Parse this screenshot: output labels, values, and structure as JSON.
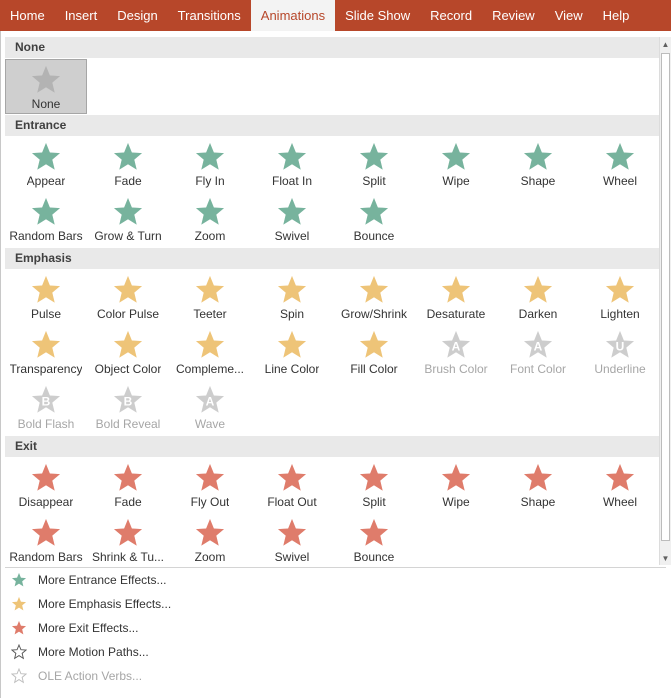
{
  "ribbon": {
    "tabs": [
      {
        "label": "Home",
        "active": false
      },
      {
        "label": "Insert",
        "active": false
      },
      {
        "label": "Design",
        "active": false
      },
      {
        "label": "Transitions",
        "active": false
      },
      {
        "label": "Animations",
        "active": true
      },
      {
        "label": "Slide Show",
        "active": false
      },
      {
        "label": "Record",
        "active": false
      },
      {
        "label": "Review",
        "active": false
      },
      {
        "label": "View",
        "active": false
      },
      {
        "label": "Help",
        "active": false
      }
    ]
  },
  "colors": {
    "ribbon": "#b7472a",
    "entrance": "#4a9a7c",
    "emphasis": "#e8b04b",
    "exit": "#d5503a",
    "disabled": "#bdbdbd",
    "none": "#9a9a9a"
  },
  "gallery": {
    "sections": [
      {
        "title": "None",
        "kind": "none",
        "items": [
          {
            "label": "None",
            "icon": "none-star-icon",
            "selected": true
          }
        ]
      },
      {
        "title": "Entrance",
        "kind": "entrance",
        "items": [
          {
            "label": "Appear",
            "icon": "appear-icon"
          },
          {
            "label": "Fade",
            "icon": "fade-icon"
          },
          {
            "label": "Fly In",
            "icon": "fly-in-icon"
          },
          {
            "label": "Float In",
            "icon": "float-in-icon"
          },
          {
            "label": "Split",
            "icon": "split-icon"
          },
          {
            "label": "Wipe",
            "icon": "wipe-icon"
          },
          {
            "label": "Shape",
            "icon": "shape-icon"
          },
          {
            "label": "Wheel",
            "icon": "wheel-icon"
          },
          {
            "label": "Random Bars",
            "icon": "random-bars-icon"
          },
          {
            "label": "Grow & Turn",
            "icon": "grow-turn-icon"
          },
          {
            "label": "Zoom",
            "icon": "zoom-icon"
          },
          {
            "label": "Swivel",
            "icon": "swivel-icon"
          },
          {
            "label": "Bounce",
            "icon": "bounce-icon"
          }
        ]
      },
      {
        "title": "Emphasis",
        "kind": "emphasis",
        "items": [
          {
            "label": "Pulse",
            "icon": "pulse-icon"
          },
          {
            "label": "Color Pulse",
            "icon": "color-pulse-icon"
          },
          {
            "label": "Teeter",
            "icon": "teeter-icon"
          },
          {
            "label": "Spin",
            "icon": "spin-icon"
          },
          {
            "label": "Grow/Shrink",
            "icon": "grow-shrink-icon"
          },
          {
            "label": "Desaturate",
            "icon": "desaturate-icon"
          },
          {
            "label": "Darken",
            "icon": "darken-icon"
          },
          {
            "label": "Lighten",
            "icon": "lighten-icon"
          },
          {
            "label": "Transparency",
            "icon": "transparency-icon"
          },
          {
            "label": "Object Color",
            "icon": "object-color-icon"
          },
          {
            "label": "Compleme...",
            "icon": "complementary-color-icon"
          },
          {
            "label": "Line Color",
            "icon": "line-color-icon"
          },
          {
            "label": "Fill Color",
            "icon": "fill-color-icon"
          },
          {
            "label": "Brush Color",
            "icon": "brush-color-icon",
            "letter": "A",
            "disabled": true
          },
          {
            "label": "Font Color",
            "icon": "font-color-icon",
            "letter": "A",
            "disabled": true
          },
          {
            "label": "Underline",
            "icon": "underline-icon",
            "letter": "U",
            "disabled": true
          },
          {
            "label": "Bold Flash",
            "icon": "bold-flash-icon",
            "letter": "B",
            "disabled": true
          },
          {
            "label": "Bold Reveal",
            "icon": "bold-reveal-icon",
            "letter": "B",
            "disabled": true
          },
          {
            "label": "Wave",
            "icon": "wave-icon",
            "letter": "A",
            "disabled": true
          }
        ]
      },
      {
        "title": "Exit",
        "kind": "exit",
        "items": [
          {
            "label": "Disappear",
            "icon": "disappear-icon"
          },
          {
            "label": "Fade",
            "icon": "fade-icon"
          },
          {
            "label": "Fly Out",
            "icon": "fly-out-icon"
          },
          {
            "label": "Float Out",
            "icon": "float-out-icon"
          },
          {
            "label": "Split",
            "icon": "split-icon"
          },
          {
            "label": "Wipe",
            "icon": "wipe-icon"
          },
          {
            "label": "Shape",
            "icon": "shape-icon"
          },
          {
            "label": "Wheel",
            "icon": "wheel-icon"
          },
          {
            "label": "Random Bars",
            "icon": "random-bars-icon"
          },
          {
            "label": "Shrink & Tu...",
            "icon": "shrink-turn-icon"
          },
          {
            "label": "Zoom",
            "icon": "zoom-icon"
          },
          {
            "label": "Swivel",
            "icon": "swivel-icon"
          },
          {
            "label": "Bounce",
            "icon": "bounce-icon"
          }
        ]
      }
    ]
  },
  "menu": {
    "items": [
      {
        "label": "More Entrance Effects...",
        "kind": "entrance",
        "icon": "entrance-star-icon",
        "disabled": false
      },
      {
        "label": "More Emphasis Effects...",
        "kind": "emphasis",
        "icon": "emphasis-star-icon",
        "disabled": false
      },
      {
        "label": "More Exit Effects...",
        "kind": "exit",
        "icon": "exit-star-icon",
        "disabled": false
      },
      {
        "label": "More Motion Paths...",
        "kind": "path",
        "icon": "motion-path-star-icon",
        "disabled": false
      },
      {
        "label": "OLE Action Verbs...",
        "kind": "ole",
        "icon": "ole-gears-icon",
        "disabled": true
      }
    ]
  }
}
